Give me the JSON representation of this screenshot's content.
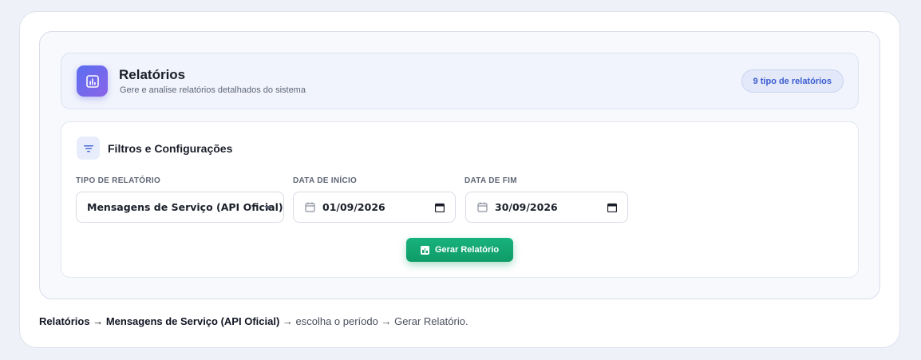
{
  "header": {
    "title": "Relatórios",
    "subtitle": "Gere e analise relatórios detalhados do sistema",
    "badge": "9 tipo de relatórios",
    "icon": "bar-chart-icon",
    "accent": "#6a67ec"
  },
  "filters": {
    "title": "Filtros e Configurações",
    "icon": "filter-icon",
    "report_type": {
      "label": "TIPO DE RELATÓRIO",
      "value": "Mensagens de Serviço (API Oficial)"
    },
    "start_date": {
      "label": "DATA DE INÍCIO",
      "value": "01/09/2026"
    },
    "end_date": {
      "label": "DATA DE FIM",
      "value": "30/09/2026"
    },
    "generate_button": {
      "label": "Gerar Relatório",
      "color": "#12a672"
    }
  },
  "caption": {
    "part1": "Relatórios",
    "arrow1": " → ",
    "part2": "Mensagens de Serviço (API Oficial)",
    "rest": " → escolha o período → Gerar Relatório."
  }
}
